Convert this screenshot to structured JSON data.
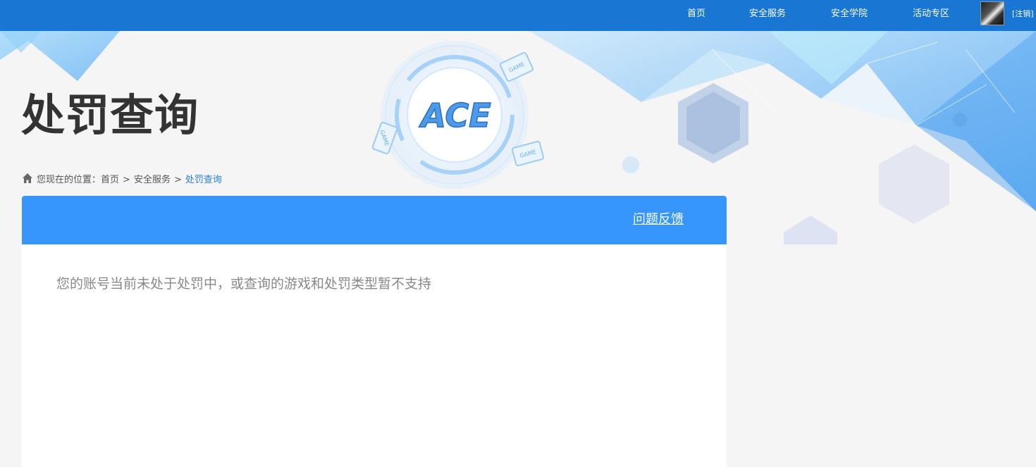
{
  "nav": {
    "items": [
      {
        "label": "首页"
      },
      {
        "label": "安全服务"
      },
      {
        "label": "安全学院"
      },
      {
        "label": "活动专区"
      }
    ],
    "logout_label": "[注销]"
  },
  "banner": {
    "logo_text": "ACE",
    "badge_text": "GAME"
  },
  "page": {
    "title": "处罚查询"
  },
  "breadcrumb": {
    "prefix": "您现在的位置：",
    "items": [
      "首页",
      "安全服务"
    ],
    "separator": ">",
    "current": "处罚查询"
  },
  "panel": {
    "feedback_label": "问题反馈",
    "message": "您的账号当前未处于处罚中，或查询的游戏和处罚类型暂不支持"
  },
  "colors": {
    "topbar": "#1976d2",
    "panel_header": "#3696fb",
    "current_crumb": "#2a7ed8"
  }
}
